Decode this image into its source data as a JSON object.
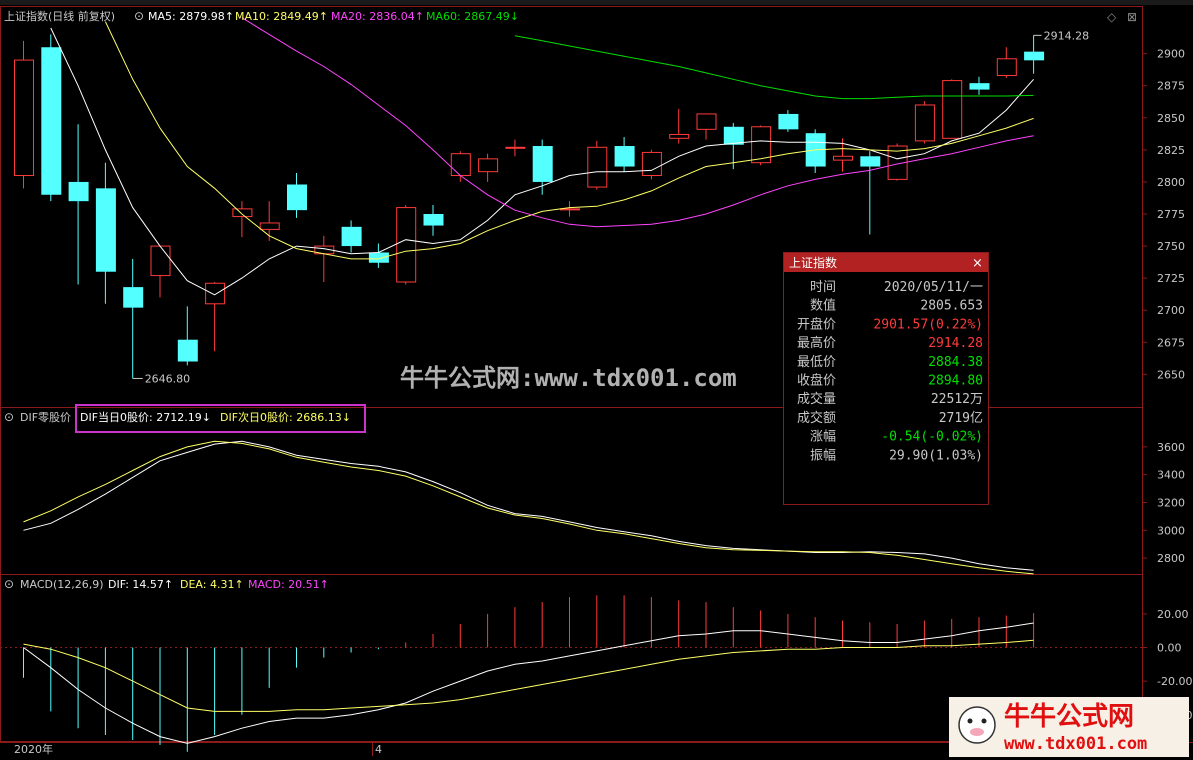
{
  "colors": {
    "bg": "#000000",
    "border": "#8b1a1a",
    "up": "#ff3a3a",
    "down": "#54ffff",
    "ma5": "#ffffff",
    "ma10": "#ffff66",
    "ma20": "#ff44ff",
    "ma60": "#00dd00",
    "text": "#c8c8c8",
    "green": "#00e000",
    "highlight": "#cc33cc"
  },
  "header": {
    "main": {
      "name": "上证指数(日线 前复权)",
      "ma5": "MA5: 2879.98↑",
      "ma10": "MA10: 2849.49↑",
      "ma20": "MA20: 2836.04↑",
      "ma60": "MA60: 2867.49↓"
    },
    "dif": {
      "name": "DIF零股价",
      "a": "DIF当日0股价: 2712.19↓",
      "b": "DIF次日0股价: 2686.13↓"
    },
    "macd": {
      "name": "MACD(12,26,9)",
      "dif": "DIF: 14.57↑",
      "dea": "DEA: 4.31↑",
      "macd": "MACD: 20.51↑"
    }
  },
  "x_axis": {
    "start_label": "2020年",
    "month_label": "4"
  },
  "popup": {
    "title": "上证指数",
    "rows": [
      {
        "label": "时间",
        "value": "2020/05/11/一",
        "color": "#c8c8c8"
      },
      {
        "label": "数值",
        "value": "2805.653",
        "color": "#c8c8c8"
      },
      {
        "label": "开盘价",
        "value": "2901.57(0.22%)",
        "color": "#ff3a3a"
      },
      {
        "label": "最高价",
        "value": "2914.28",
        "color": "#ff3a3a"
      },
      {
        "label": "最低价",
        "value": "2884.38",
        "color": "#00e000"
      },
      {
        "label": "收盘价",
        "value": "2894.80",
        "color": "#00e000"
      },
      {
        "label": "成交量",
        "value": "22512万",
        "color": "#c8c8c8"
      },
      {
        "label": "成交额",
        "value": "2719亿",
        "color": "#c8c8c8"
      },
      {
        "label": "涨幅",
        "value": "-0.54(-0.02%)",
        "color": "#00e000"
      },
      {
        "label": "振幅",
        "value": "29.90(1.03%)",
        "color": "#c8c8c8"
      }
    ]
  },
  "watermark": "牛牛公式网:www.tdx001.com",
  "logo": {
    "line1": "牛牛公式网",
    "line2": "www.tdx001.com"
  },
  "chart_data": [
    {
      "type": "candlestick",
      "title": "上证指数(日线 前复权)",
      "ylim": [
        2630,
        2920
      ],
      "y_ticks": [
        2650,
        2675,
        2700,
        2725,
        2750,
        2775,
        2800,
        2825,
        2850,
        2875,
        2900
      ],
      "annotations": [
        {
          "text": "2646.80",
          "index": 4,
          "value": 2646.8
        },
        {
          "text": "2914.28",
          "index": 37,
          "value": 2914.28
        }
      ],
      "candles": [
        {
          "o": 2805,
          "h": 2910,
          "l": 2795,
          "c": 2895
        },
        {
          "o": 2905,
          "h": 2915,
          "l": 2785,
          "c": 2790
        },
        {
          "o": 2800,
          "h": 2845,
          "l": 2720,
          "c": 2785
        },
        {
          "o": 2795,
          "h": 2815,
          "l": 2705,
          "c": 2730
        },
        {
          "o": 2718,
          "h": 2740,
          "l": 2646.8,
          "c": 2702
        },
        {
          "o": 2727,
          "h": 2750,
          "l": 2710,
          "c": 2750
        },
        {
          "o": 2677,
          "h": 2703,
          "l": 2657,
          "c": 2660
        },
        {
          "o": 2705,
          "h": 2722,
          "l": 2668,
          "c": 2721
        },
        {
          "o": 2773,
          "h": 2785,
          "l": 2757,
          "c": 2779
        },
        {
          "o": 2763,
          "h": 2785,
          "l": 2754,
          "c": 2768
        },
        {
          "o": 2798,
          "h": 2807,
          "l": 2772,
          "c": 2778
        },
        {
          "o": 2744,
          "h": 2758,
          "l": 2722,
          "c": 2750
        },
        {
          "o": 2765,
          "h": 2770,
          "l": 2745,
          "c": 2750
        },
        {
          "o": 2745,
          "h": 2752,
          "l": 2733,
          "c": 2737
        },
        {
          "o": 2722,
          "h": 2782,
          "l": 2720,
          "c": 2780
        },
        {
          "o": 2775,
          "h": 2782,
          "l": 2758,
          "c": 2766
        },
        {
          "o": 2805,
          "h": 2824,
          "l": 2800,
          "c": 2822
        },
        {
          "o": 2808,
          "h": 2822,
          "l": 2800,
          "c": 2818
        },
        {
          "o": 2827,
          "h": 2833,
          "l": 2820,
          "c": 2827
        },
        {
          "o": 2828,
          "h": 2833,
          "l": 2790,
          "c": 2800
        },
        {
          "o": 2779,
          "h": 2785,
          "l": 2773,
          "c": 2779
        },
        {
          "o": 2796,
          "h": 2832,
          "l": 2794,
          "c": 2827
        },
        {
          "o": 2828,
          "h": 2835,
          "l": 2808,
          "c": 2812
        },
        {
          "o": 2805,
          "h": 2825,
          "l": 2802,
          "c": 2823
        },
        {
          "o": 2834,
          "h": 2857,
          "l": 2830,
          "c": 2837
        },
        {
          "o": 2841,
          "h": 2852,
          "l": 2833,
          "c": 2853
        },
        {
          "o": 2843,
          "h": 2846,
          "l": 2810,
          "c": 2829
        },
        {
          "o": 2815,
          "h": 2844,
          "l": 2813,
          "c": 2843
        },
        {
          "o": 2853,
          "h": 2856,
          "l": 2839,
          "c": 2841
        },
        {
          "o": 2838,
          "h": 2841,
          "l": 2807,
          "c": 2812
        },
        {
          "o": 2817,
          "h": 2834,
          "l": 2808,
          "c": 2820
        },
        {
          "o": 2820,
          "h": 2824,
          "l": 2759,
          "c": 2812
        },
        {
          "o": 2802,
          "h": 2830,
          "l": 2801,
          "c": 2828
        },
        {
          "o": 2832,
          "h": 2863,
          "l": 2830,
          "c": 2860
        },
        {
          "o": 2834,
          "h": 2880,
          "l": 2834,
          "c": 2879
        },
        {
          "o": 2877,
          "h": 2882,
          "l": 2868,
          "c": 2872
        },
        {
          "o": 2883,
          "h": 2905,
          "l": 2881,
          "c": 2896
        },
        {
          "o": 2901.57,
          "h": 2914.28,
          "l": 2884.38,
          "c": 2894.8
        }
      ],
      "series": [
        {
          "name": "MA5",
          "color": "#ffffff",
          "values": [
            2960,
            2920,
            2875,
            2825,
            2780,
            2750,
            2723,
            2712,
            2725,
            2740,
            2750,
            2748,
            2744,
            2745,
            2755,
            2752,
            2755,
            2770,
            2790,
            2797,
            2805,
            2808,
            2808,
            2809,
            2820,
            2828,
            2830,
            2832,
            2831,
            2831,
            2830,
            2825,
            2818,
            2822,
            2832,
            2838,
            2856,
            2879.98
          ]
        },
        {
          "name": "MA10",
          "color": "#ffff66",
          "values": [
            3020,
            2990,
            2960,
            2925,
            2880,
            2842,
            2812,
            2795,
            2775,
            2758,
            2748,
            2744,
            2740,
            2740,
            2746,
            2748,
            2752,
            2762,
            2770,
            2777,
            2780,
            2781,
            2786,
            2793,
            2803,
            2812,
            2815,
            2818,
            2822,
            2825,
            2826,
            2825,
            2824,
            2826,
            2830,
            2836,
            2842,
            2849.49
          ]
        },
        {
          "name": "MA20",
          "color": "#ff44ff",
          "values": [
            3030,
            3018,
            3005,
            2992,
            2978,
            2966,
            2955,
            2942,
            2928,
            2915,
            2902,
            2890,
            2876,
            2860,
            2844,
            2825,
            2805,
            2790,
            2778,
            2772,
            2767,
            2765,
            2766,
            2767,
            2770,
            2775,
            2782,
            2790,
            2797,
            2802,
            2806,
            2809,
            2814,
            2818,
            2822,
            2827,
            2832,
            2836.04
          ]
        },
        {
          "name": "MA60",
          "color": "#00dd00",
          "values": [
            null,
            null,
            null,
            null,
            null,
            null,
            null,
            null,
            null,
            null,
            null,
            null,
            null,
            null,
            null,
            null,
            null,
            null,
            2914,
            2910,
            2906,
            2902,
            2898,
            2894,
            2890,
            2885,
            2880,
            2875,
            2871,
            2867,
            2865,
            2865,
            2866,
            2867,
            2867,
            2867,
            2867,
            2867.49
          ]
        }
      ]
    },
    {
      "type": "line",
      "title": "DIF零股价",
      "ylim": [
        2700,
        3750
      ],
      "y_ticks": [
        2800,
        3000,
        3200,
        3400,
        3600
      ],
      "series": [
        {
          "name": "DIF当日0股价",
          "color": "#ffffff",
          "values": [
            3000,
            3050,
            3150,
            3260,
            3380,
            3500,
            3560,
            3620,
            3640,
            3600,
            3540,
            3510,
            3480,
            3460,
            3420,
            3350,
            3270,
            3180,
            3120,
            3100,
            3060,
            3020,
            2990,
            2960,
            2920,
            2890,
            2870,
            2860,
            2850,
            2840,
            2840,
            2845,
            2840,
            2830,
            2800,
            2760,
            2730,
            2712.19
          ]
        },
        {
          "name": "DIF次日0股价",
          "color": "#ffff66",
          "values": [
            3060,
            3140,
            3240,
            3330,
            3430,
            3530,
            3600,
            3640,
            3625,
            3585,
            3525,
            3490,
            3455,
            3430,
            3390,
            3320,
            3240,
            3160,
            3110,
            3085,
            3045,
            3000,
            2975,
            2940,
            2905,
            2875,
            2860,
            2855,
            2850,
            2845,
            2845,
            2840,
            2820,
            2790,
            2760,
            2730,
            2705,
            2686.13
          ]
        }
      ]
    },
    {
      "type": "bar",
      "title": "MACD(12,26,9)",
      "ylim": [
        -55,
        33
      ],
      "y_ticks": [
        20,
        0,
        -20,
        -40
      ],
      "bar_series": "MACD",
      "series": [
        {
          "name": "MACD",
          "values": [
            -18,
            -38,
            -48,
            -52,
            -55,
            -58,
            -62,
            -52,
            -40,
            -24,
            -12,
            -6,
            -3,
            -1,
            3,
            8,
            14,
            20,
            24,
            27,
            30,
            31,
            31,
            30,
            28,
            27,
            24,
            22,
            20,
            18,
            16,
            15,
            14,
            16,
            17,
            18,
            19,
            20.51
          ]
        },
        {
          "name": "DIF",
          "color": "#ffffff",
          "values": [
            0,
            -12,
            -25,
            -36,
            -45,
            -53,
            -57,
            -53,
            -48,
            -44,
            -42,
            -42,
            -40,
            -37,
            -33,
            -26,
            -20,
            -14,
            -10,
            -8,
            -5,
            -2,
            1,
            4,
            7,
            8,
            10,
            10,
            8,
            6,
            4,
            3,
            3,
            5,
            7,
            10,
            12,
            14.57
          ]
        },
        {
          "name": "DEA",
          "color": "#ffff66",
          "values": [
            2,
            -1,
            -6,
            -12,
            -20,
            -28,
            -36,
            -38,
            -38,
            -38,
            -37,
            -37,
            -36,
            -35,
            -34,
            -33,
            -31,
            -28,
            -25,
            -22,
            -19,
            -16,
            -13,
            -10,
            -7,
            -5,
            -3,
            -2,
            -1,
            -1,
            0,
            0,
            0,
            1,
            1,
            2,
            3,
            4.31
          ]
        }
      ]
    }
  ]
}
